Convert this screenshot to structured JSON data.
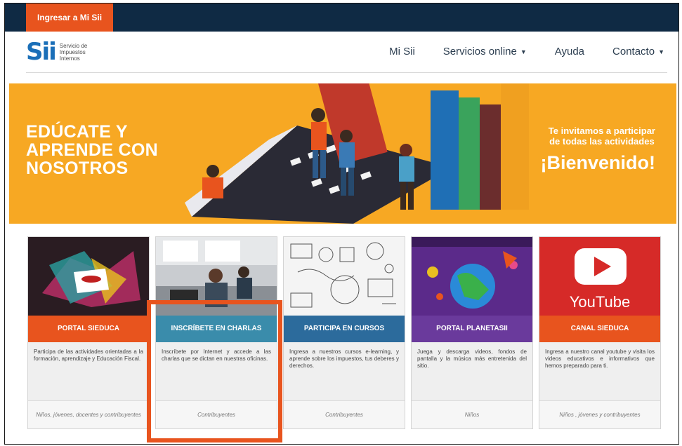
{
  "topbar": {
    "login_label": "Ingresar a Mi Sii"
  },
  "logo": {
    "mark": "Sii",
    "text": "Servicio de Impuestos Internos"
  },
  "nav": [
    {
      "label": "Mi Sii",
      "has_caret": false
    },
    {
      "label": "Servicios online",
      "has_caret": true
    },
    {
      "label": "Ayuda",
      "has_caret": false
    },
    {
      "label": "Contacto",
      "has_caret": true
    }
  ],
  "hero": {
    "title_lines": [
      "EDÚCATE Y",
      "APRENDE CON",
      "NOSOTROS"
    ],
    "invite_lines": [
      "Te invitamos a participar",
      "de todas las actividades"
    ],
    "welcome": "¡Bienvenido!"
  },
  "cards": [
    {
      "title": "PORTAL SIEDUCA",
      "color": "#e8541e",
      "description": "Participa de las actividades orientadas a la formación, aprendizaje y Educación Fiscal.",
      "footer": "Niños, jóvenes, docentes y contribuyentes"
    },
    {
      "title": "INSCRÍBETE EN CHARLAS",
      "color": "#3a8cab",
      "description": "Inscríbete por Internet y accede a las charlas que se dictan en nuestras oficinas.",
      "footer": "Contribuyentes"
    },
    {
      "title": "PARTICIPA EN CURSOS",
      "color": "#2c6b9c",
      "description": "Ingresa a nuestros cursos e-learning, y aprende sobre los impuestos, tus deberes y derechos.",
      "footer": "Contribuyentes"
    },
    {
      "title": "PORTAL PLANETASII",
      "color": "#6a3a9c",
      "description": "Juega y descarga videos, fondos de pantalla y la música más entretenida del sitio.",
      "footer": "Niños"
    },
    {
      "title": "CANAL SIEDUCA",
      "color": "#e8541e",
      "description": "Ingresa a nuestro canal youtube y visita los videos educativos e informativos que hemos preparado para ti.",
      "footer": "Niños , jóvenes y contribuyentes",
      "youtube_text": "YouTube"
    }
  ]
}
